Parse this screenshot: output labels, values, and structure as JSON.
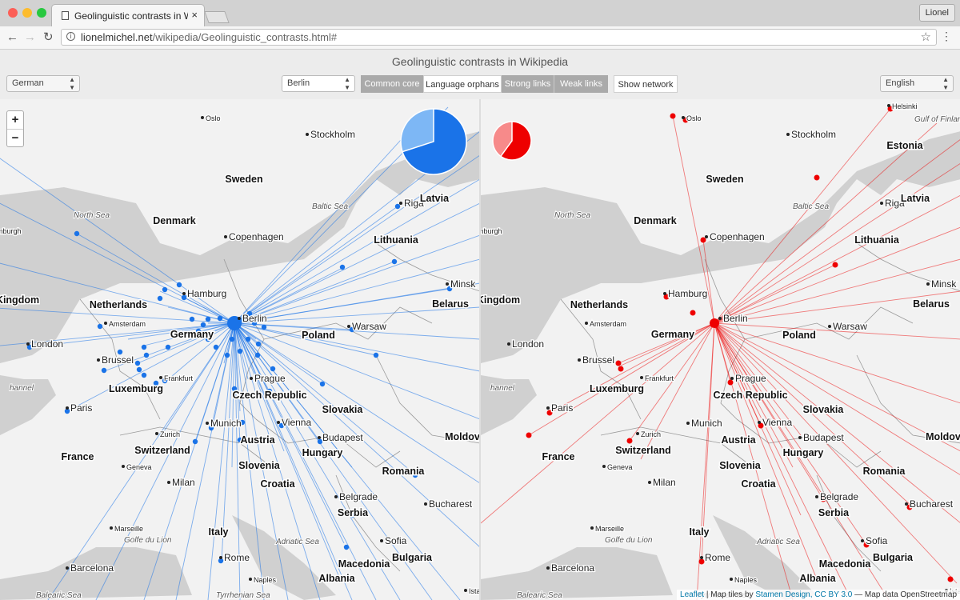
{
  "browser": {
    "tab_title": "Geolinguistic contrasts in Wikipedia",
    "tab_close": "×",
    "user": "Lionel",
    "url_host": "lionelmichel.net",
    "url_path": "/wikipedia/Geolinguistic_contrasts.html#",
    "nav_back": "←",
    "nav_forward": "→",
    "nav_reload": "↻",
    "info_glyph": "i",
    "star": "☆",
    "menu": "⋮"
  },
  "app": {
    "title": "Geolinguistic contrasts in Wikipedia",
    "left_language": "German",
    "right_language": "English",
    "city": "Berlin",
    "buttons": [
      {
        "label": "Common core",
        "state": "active"
      },
      {
        "label": "Language orphans",
        "state": "plain"
      },
      {
        "label": "Strong links",
        "state": "active"
      },
      {
        "label": "Weak links",
        "state": "active"
      },
      {
        "label": "Show network",
        "state": "plain"
      }
    ]
  },
  "map": {
    "zoom_in": "+",
    "zoom_out": "−",
    "attribution": {
      "leaflet": "Leaflet",
      "sep1": " | Map tiles by ",
      "stamen": "Stamen Design, CC BY 3.0",
      "sep2": " — Map data OpenStreetmap"
    },
    "countries": [
      {
        "name": "Sweden"
      },
      {
        "name": "Denmark"
      },
      {
        "name": "Latvia"
      },
      {
        "name": "Lithuania"
      },
      {
        "name": "Netherlands"
      },
      {
        "name": "Germany"
      },
      {
        "name": "Belarus"
      },
      {
        "name": "Poland"
      },
      {
        "name": "Luxemburg"
      },
      {
        "name": "Czech Republic"
      },
      {
        "name": "Slovakia"
      },
      {
        "name": "Switzerland"
      },
      {
        "name": "Austria"
      },
      {
        "name": "Hungary"
      },
      {
        "name": "France"
      },
      {
        "name": "Slovenia"
      },
      {
        "name": "Croatia"
      },
      {
        "name": "Romania"
      },
      {
        "name": "Moldov"
      },
      {
        "name": "Serbia"
      },
      {
        "name": "Italy"
      },
      {
        "name": "Bulgaria"
      },
      {
        "name": "Macedonia"
      },
      {
        "name": "Albania"
      },
      {
        "name": "Kingdom"
      },
      {
        "name": "Estonia"
      }
    ],
    "cities": [
      {
        "name": "Oslo"
      },
      {
        "name": "Stockholm"
      },
      {
        "name": "Riga"
      },
      {
        "name": "Copenhagen"
      },
      {
        "name": "Hamburg"
      },
      {
        "name": "Minsk"
      },
      {
        "name": "Berlin"
      },
      {
        "name": "Amsterdam"
      },
      {
        "name": "Warsaw"
      },
      {
        "name": "London"
      },
      {
        "name": "Brussel"
      },
      {
        "name": "Frankfurt"
      },
      {
        "name": "Prague"
      },
      {
        "name": "Paris"
      },
      {
        "name": "Vienna"
      },
      {
        "name": "Munich"
      },
      {
        "name": "Zurich"
      },
      {
        "name": "Budapest"
      },
      {
        "name": "Geneva"
      },
      {
        "name": "Milan"
      },
      {
        "name": "Belgrade"
      },
      {
        "name": "Bucharest"
      },
      {
        "name": "Marseille"
      },
      {
        "name": "Sofia"
      },
      {
        "name": "Rome"
      },
      {
        "name": "Barcelona"
      },
      {
        "name": "Naples"
      },
      {
        "name": "Ista"
      },
      {
        "name": "mburgh"
      },
      {
        "name": "Helsinki"
      }
    ],
    "seas": [
      {
        "name": "North Sea"
      },
      {
        "name": "Baltic Sea"
      },
      {
        "name": "Golfe du Lion"
      },
      {
        "name": "Adriatic Sea"
      },
      {
        "name": "Tyrrhenian Sea"
      },
      {
        "name": "Balearic Sea"
      },
      {
        "name": "Gulf of Finland"
      },
      {
        "name": "hannel"
      }
    ]
  },
  "colors": {
    "left_accent": "#1a73e8",
    "right_accent": "#ee0000",
    "land": "#f2f2f2",
    "water": "#d0d0d0"
  }
}
